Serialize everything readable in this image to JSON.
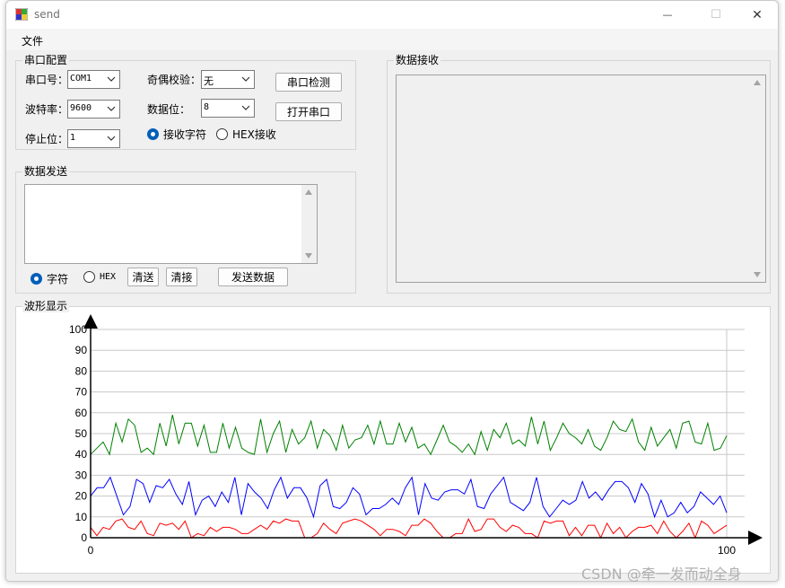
{
  "window": {
    "title": "send",
    "controls": {
      "minimize": "—",
      "maximize": "☐",
      "close": "✕"
    }
  },
  "menu": {
    "file": "文件"
  },
  "serial_config": {
    "title": "串口配置",
    "port_label": "串口号：",
    "port_value": "COM1",
    "baud_label": "波特率：",
    "baud_value": "9600",
    "stop_label": "停止位：",
    "stop_value": "1",
    "parity_label": "奇偶校验：",
    "parity_value": "无",
    "databits_label": "数据位：",
    "databits_value": "8",
    "detect_button": "串口检测",
    "open_button": "打开串口",
    "recv_char_radio": "接收字符",
    "recv_hex_radio": "HEX接收"
  },
  "data_send": {
    "title": "数据发送",
    "char_radio": "字符",
    "hex_radio": "HEX",
    "clear_send_button": "清送",
    "clear_recv_button": "清接",
    "send_button": "发送数据"
  },
  "data_receive": {
    "title": "数据接收"
  },
  "waveform": {
    "title": "波形显示"
  },
  "colors": {
    "green": "#008000",
    "blue": "#0000ff",
    "red": "#ff0000",
    "accent": "#005fb8"
  },
  "chart_data": {
    "type": "line",
    "x_range": [
      0,
      100
    ],
    "ylim": [
      0,
      100
    ],
    "yticks": [
      "0",
      "10",
      "20",
      "30",
      "40",
      "50",
      "60",
      "70",
      "80",
      "90",
      "100"
    ],
    "xticks": [
      "0",
      "100"
    ],
    "grid": true,
    "series": [
      {
        "color": "#008000",
        "values": [
          40,
          43,
          46,
          40,
          55,
          46,
          57,
          54,
          41,
          43,
          40,
          55,
          44,
          59,
          45,
          55,
          55,
          44,
          54,
          41,
          41,
          55,
          43,
          53,
          43,
          41,
          40,
          57,
          41,
          50,
          56,
          41,
          52,
          45,
          48,
          56,
          43,
          52,
          49,
          42,
          54,
          43,
          47,
          48,
          54,
          45,
          56,
          45,
          45,
          55,
          46,
          53,
          43,
          45,
          40,
          47,
          54,
          46,
          44,
          41,
          45,
          40,
          51,
          42,
          52,
          48,
          55,
          45,
          47,
          44,
          58,
          45,
          56,
          42,
          48,
          55,
          50,
          48,
          45,
          52,
          44,
          42,
          48,
          56,
          52,
          51,
          57,
          46,
          42,
          53,
          44,
          48,
          52,
          43,
          55,
          56,
          46,
          45,
          55,
          42,
          43,
          49
        ]
      },
      {
        "color": "#0000ff",
        "values": [
          20,
          24,
          24,
          29,
          20,
          11,
          15,
          28,
          26,
          17,
          25,
          24,
          28,
          21,
          16,
          27,
          11,
          18,
          20,
          15,
          22,
          17,
          29,
          11,
          26,
          22,
          19,
          14,
          23,
          29,
          19,
          24,
          24,
          19,
          10,
          25,
          28,
          15,
          14,
          17,
          24,
          21,
          11,
          14,
          14,
          16,
          19,
          16,
          24,
          29,
          11,
          26,
          19,
          18,
          22,
          23,
          23,
          21,
          28,
          15,
          14,
          21,
          25,
          29,
          17,
          15,
          13,
          17,
          29,
          15,
          10,
          14,
          18,
          16,
          18,
          27,
          19,
          22,
          18,
          23,
          27,
          27,
          24,
          17,
          26,
          21,
          10,
          18,
          10,
          12,
          17,
          12,
          15,
          22,
          19,
          16,
          20,
          12
        ]
      },
      {
        "color": "#ff0000",
        "values": [
          5,
          1,
          5,
          4,
          8,
          9,
          5,
          4,
          8,
          2,
          1,
          7,
          6,
          7,
          4,
          8,
          0,
          2,
          1,
          5,
          3,
          5,
          5,
          4,
          2,
          2,
          4,
          6,
          4,
          8,
          7,
          9,
          8,
          8,
          0,
          0,
          2,
          7,
          4,
          2,
          7,
          8,
          9,
          8,
          6,
          4,
          1,
          4,
          4,
          3,
          1,
          6,
          6,
          9,
          7,
          3,
          0,
          0,
          2,
          2,
          9,
          3,
          4,
          9,
          9,
          5,
          3,
          6,
          5,
          2,
          2,
          0,
          8,
          7,
          8,
          8,
          1,
          5,
          1,
          6,
          6,
          0,
          7,
          2,
          5,
          0,
          3,
          5,
          5,
          6,
          2,
          8,
          3,
          0,
          3,
          7,
          0,
          8,
          6,
          2,
          4,
          6
        ]
      }
    ]
  },
  "watermark": "CSDN @牵一发而动全身"
}
